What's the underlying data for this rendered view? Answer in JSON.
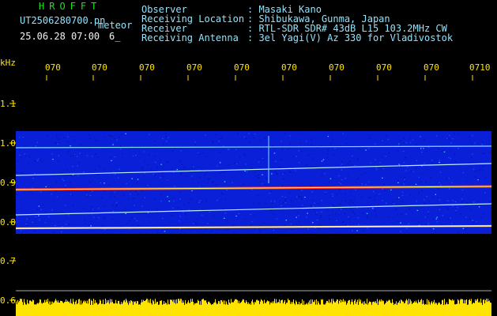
{
  "header": {
    "brand": "HROFFT",
    "filename": "UT2506280700.pn",
    "mode": "meteor",
    "datetime": "25.06.28 07:00",
    "value": "6_",
    "fields": [
      {
        "label": "Observer",
        "value": ": Masaki Kano"
      },
      {
        "label": "Receiving Location",
        "value": ": Shibukawa, Gunma, Japan"
      },
      {
        "label": "Receiver",
        "value": ": RTL-SDR SDR# 43dB L15 103.2MHz CW"
      },
      {
        "label": "Receiving Antenna",
        "value": ": 3el Yagi(V) Az 330 for Vladivostok"
      }
    ]
  },
  "axis": {
    "unit": "kHz",
    "y_ticks": [
      "1.1",
      "1.0",
      "0.9",
      "0.8",
      "0.7",
      "0.6"
    ],
    "x_ticks": [
      "070",
      "070",
      "070",
      "070",
      "070",
      "070",
      "070",
      "070",
      "070",
      "0710"
    ]
  },
  "colors": {
    "background": "#000000",
    "axis_text": "#ffe400",
    "header_text": "#8fe3ff",
    "brand": "#17e817",
    "noise_band": "#0a1fd8",
    "signal": "#ffffff",
    "strong_signal": "#ff3a1a",
    "level_bar": "#ffe400"
  }
}
